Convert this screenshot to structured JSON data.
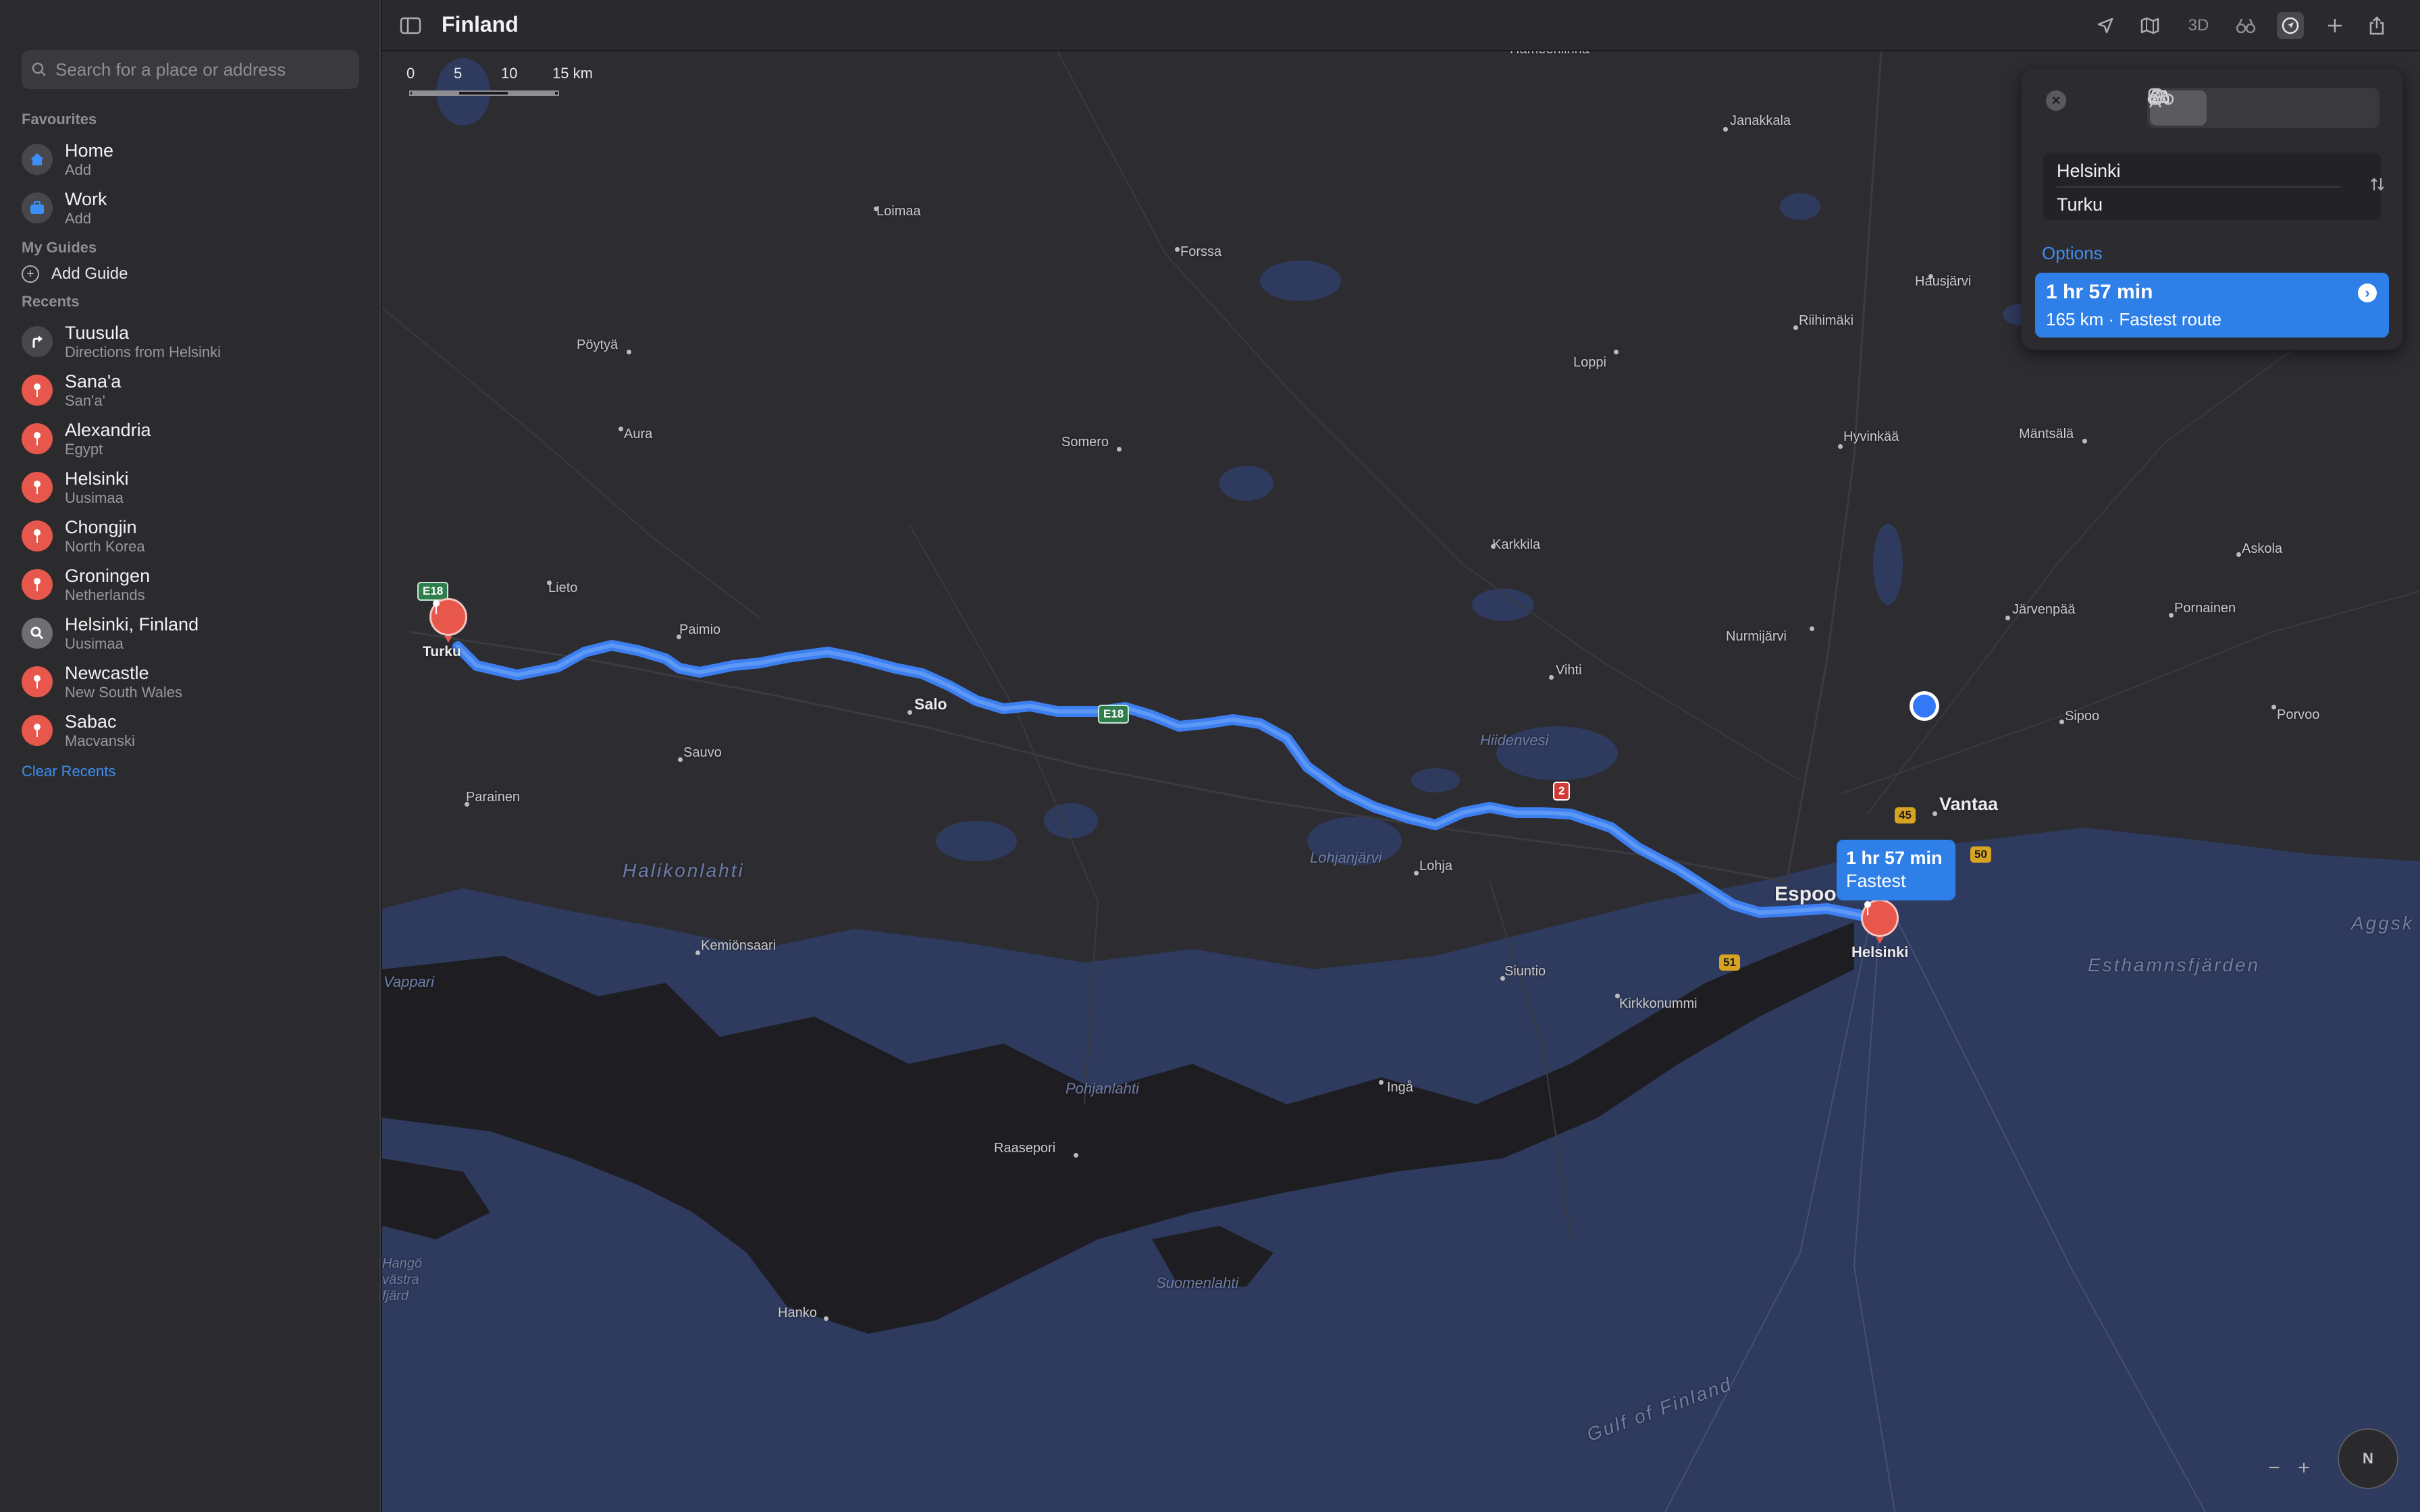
{
  "window": {
    "title": "Finland"
  },
  "search": {
    "placeholder": "Search for a place or address"
  },
  "favourites": {
    "label": "Favourites",
    "items": [
      {
        "title": "Home",
        "subtitle": "Add",
        "icon": "home-icon"
      },
      {
        "title": "Work",
        "subtitle": "Add",
        "icon": "briefcase-icon"
      }
    ]
  },
  "guides": {
    "label": "My Guides",
    "add_label": "Add Guide"
  },
  "recents": {
    "label": "Recents",
    "items": [
      {
        "title": "Tuusula",
        "subtitle": "Directions from Helsinki",
        "icon": "directions-icon"
      },
      {
        "title": "Sana'a",
        "subtitle": "San'a'",
        "icon": "pin-icon"
      },
      {
        "title": "Alexandria",
        "subtitle": "Egypt",
        "icon": "pin-icon"
      },
      {
        "title": "Helsinki",
        "subtitle": "Uusimaa",
        "icon": "pin-icon"
      },
      {
        "title": "Chongjin",
        "subtitle": "North Korea",
        "icon": "pin-icon"
      },
      {
        "title": "Groningen",
        "subtitle": "Netherlands",
        "icon": "pin-icon"
      },
      {
        "title": "Helsinki, Finland",
        "subtitle": "Uusimaa",
        "icon": "search-icon"
      },
      {
        "title": "Newcastle",
        "subtitle": "New South Wales",
        "icon": "pin-icon"
      },
      {
        "title": "Sabac",
        "subtitle": "Macvanski",
        "icon": "pin-icon"
      }
    ],
    "clear_label": "Clear Recents"
  },
  "toolbar": {
    "buttons": [
      "location-arrow-icon",
      "map-icon",
      "3D",
      "binoculars-icon",
      "tracking-icon",
      "plus-icon",
      "share-icon"
    ]
  },
  "scale": {
    "labels": [
      "0",
      "5",
      "10",
      "15 km"
    ]
  },
  "map": {
    "places": {
      "hameenlinna": "Hämeenlinna",
      "janakkala": "Janakkala",
      "loimaa": "Loimaa",
      "forssa": "Forssa",
      "hausjarvi": "Hausjärvi",
      "riihimaki": "Riihimäki",
      "poytya": "Pöytyä",
      "loppi": "Loppi",
      "aura": "Aura",
      "somero": "Somero",
      "hyvinkaa": "Hyvinkää",
      "mantsala": "Mäntsälä",
      "karkkila": "Karkkila",
      "askola": "Askola",
      "lieto": "Lieto",
      "turku": "Turku",
      "paimio": "Paimio",
      "nurmijarvi": "Nurmijärvi",
      "jarvenpaa": "Järvenpää",
      "pornainen": "Pornainen",
      "vihti": "Vihti",
      "salo": "Salo",
      "sipoo": "Sipoo",
      "porvoo": "Porvoo",
      "sauvo": "Sauvo",
      "hiidenvesi": "Hiidenvesi",
      "parainen": "Parainen",
      "vantaa": "Vantaa",
      "halikonlahti": "Halikonlahti",
      "lohjanjarvi": "Lohjanjärvi",
      "lohja": "Lohja",
      "espoo": "Espoo",
      "helsinki": "Helsinki",
      "kemionsaari": "Kemiönsaari",
      "vappari": "Vappari",
      "siuntio": "Siuntio",
      "kirkkonummi": "Kirkkonummi",
      "esthamnsfjarden": "Esthamnsfjärden",
      "aggsk": "Aggsk",
      "pohjanlahti": "Pohjanlahti",
      "inga": "Ingå",
      "raasepori": "Raasepori",
      "hango_vastra_fjard": "Hangö\nvästra\nfjärd",
      "suomenlahti": "Suomenlahti",
      "hanko": "Hanko",
      "gulf_of_finland": "Gulf of Finland"
    },
    "shields": {
      "e18a": "E18",
      "e18b": "E18",
      "r2": "2",
      "r45": "45",
      "r50": "50",
      "r51": "51"
    },
    "route_callout": {
      "duration": "1 hr 57 min",
      "label": "Fastest"
    }
  },
  "directions": {
    "modes": [
      "car-icon",
      "walk-icon",
      "transit-icon",
      "bike-icon"
    ],
    "active_mode": "car-icon",
    "from": "Helsinki",
    "to": "Turku",
    "options_label": "Options",
    "route": {
      "duration": "1 hr 57 min",
      "details": "165 km · Fastest route"
    }
  },
  "compass": {
    "label": "N"
  },
  "colors": {
    "route": "#3d7ff0",
    "pin": "#e8574b",
    "accent": "#3d8ef7",
    "water": "#2f3b5e",
    "land": "#2c2c31"
  }
}
